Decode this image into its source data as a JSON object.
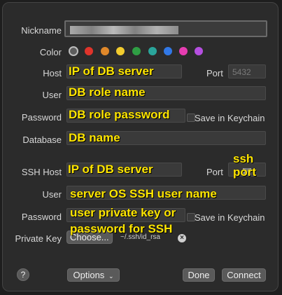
{
  "labels": {
    "nickname": "Nickname",
    "color": "Color",
    "host": "Host",
    "port": "Port",
    "user": "User",
    "password": "Password",
    "save_in_keychain": "Save in Keychain",
    "database": "Database",
    "ssh_host": "SSH Host",
    "ssh_port": "Port",
    "ssh_user": "User",
    "ssh_password": "Password",
    "ssh_save_in_keychain": "Save in Keychain",
    "private_key": "Private Key"
  },
  "fields": {
    "port_placeholder": "5432",
    "private_key_path": "~/.ssh/id_rsa"
  },
  "colors": [
    "#5d5d5d",
    "#e0342b",
    "#e0882a",
    "#f2cc2e",
    "#2f9e44",
    "#2aa59b",
    "#3178e6",
    "#e63db1",
    "#b54fe0"
  ],
  "annotations": {
    "host": "IP of DB server",
    "user": "DB role name",
    "password": "DB role password",
    "database": "DB name",
    "ssh_host": "IP of DB server",
    "ssh_port": "ssh\nport",
    "ssh_user": "server OS SSH user name",
    "ssh_password_line1": "user private key or",
    "ssh_password_line2": "password for SSH"
  },
  "buttons": {
    "choose": "Choose...",
    "options": "Options",
    "done": "Done",
    "connect": "Connect",
    "help": "?"
  }
}
